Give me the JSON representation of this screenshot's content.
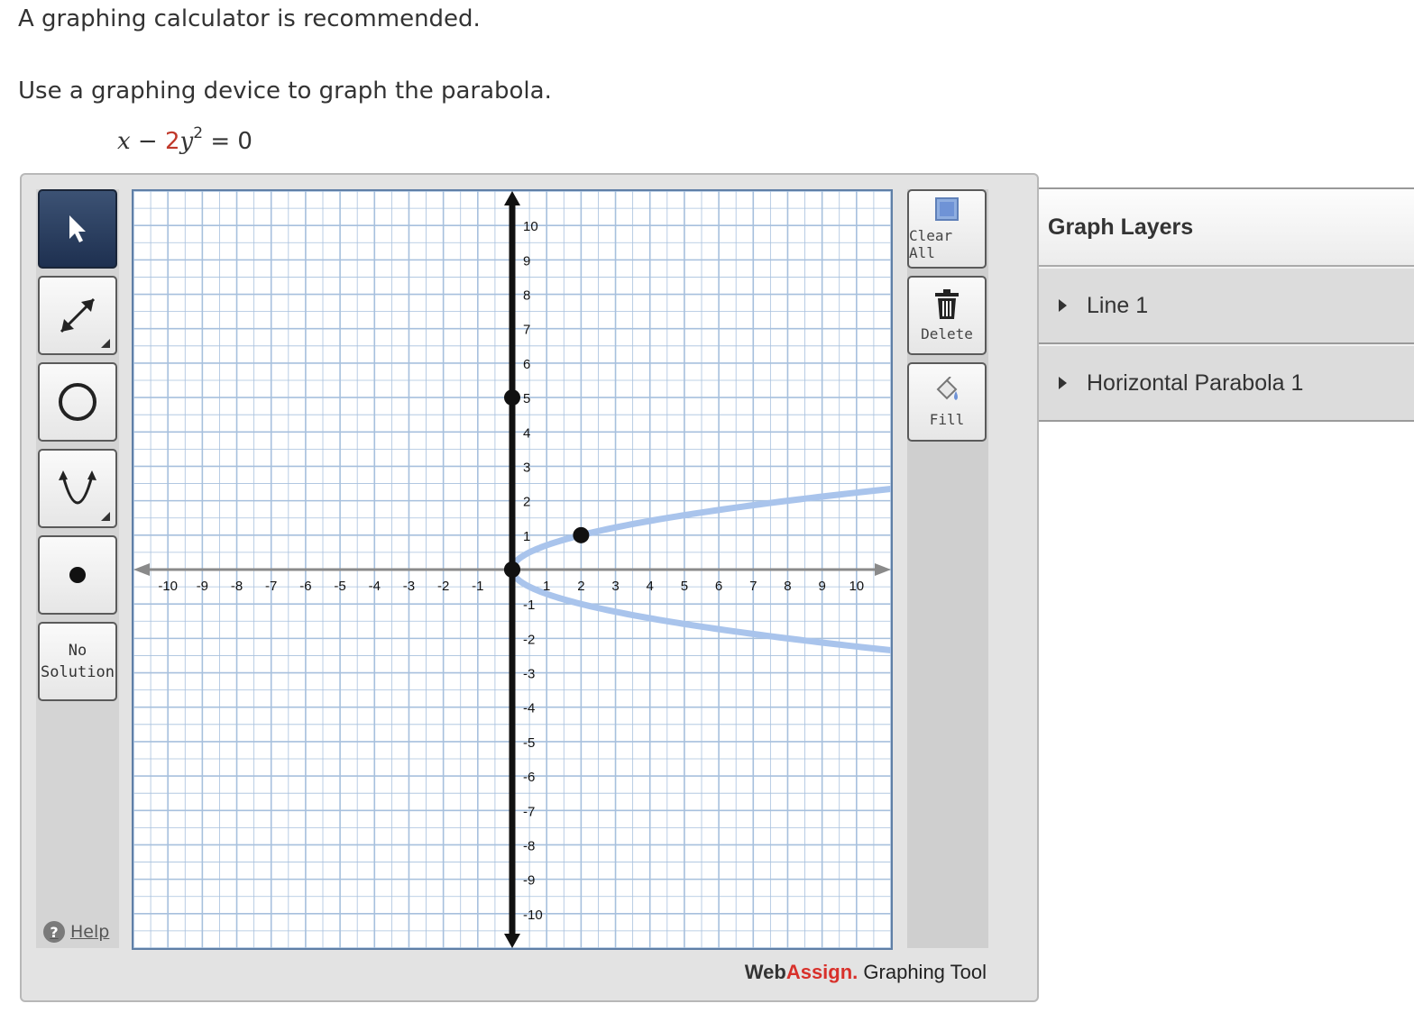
{
  "page": {
    "note": "A graphing calculator is recommended.",
    "instruction": "Use a graphing device to graph the parabola.",
    "equation": {
      "x": "x",
      "minus": " − ",
      "coef": "2",
      "y": "y",
      "exp": "2",
      "rest": " = 0"
    }
  },
  "toolbar_left": {
    "tools": [
      {
        "id": "select",
        "icon": "pointer-arrow-icon",
        "active": true
      },
      {
        "id": "line",
        "icon": "double-arrow-line-icon"
      },
      {
        "id": "circle",
        "icon": "circle-icon"
      },
      {
        "id": "parabola",
        "icon": "parabola-icon"
      },
      {
        "id": "point",
        "icon": "point-icon"
      }
    ],
    "no_solution_line1": "No",
    "no_solution_line2": "Solution",
    "help_label": "Help"
  },
  "toolbar_right": {
    "clear_all": "Clear All",
    "delete": "Delete",
    "fill": "Fill"
  },
  "brand": {
    "web": "Web",
    "assign": "Assign.",
    "tool": " Graphing Tool"
  },
  "layers": {
    "title": "Graph Layers",
    "items": [
      "Line 1",
      "Horizontal Parabola 1"
    ]
  },
  "graph": {
    "x_range": [
      -11,
      11
    ],
    "y_range": [
      -11,
      11
    ],
    "x_ticks": [
      -10,
      -9,
      -8,
      -7,
      -6,
      -5,
      -4,
      -3,
      -2,
      -1,
      1,
      2,
      3,
      4,
      5,
      6,
      7,
      8,
      9,
      10
    ],
    "y_ticks": [
      10,
      9,
      8,
      7,
      6,
      5,
      4,
      3,
      2,
      1,
      -1,
      -2,
      -3,
      -4,
      -5,
      -6,
      -7,
      -8,
      -9,
      -10
    ],
    "line_1": {
      "type": "vertical",
      "x": 0,
      "color": "#111111"
    },
    "line_points": [
      [
        0,
        5
      ],
      [
        0,
        0
      ]
    ],
    "parabola": {
      "type": "horizontal",
      "equation": "x = 2y^2",
      "vertex": [
        0,
        0
      ],
      "point": [
        2,
        1
      ],
      "color": "#a9c4ec"
    },
    "grid_color": "#a7c0dd",
    "axis_color": "#8a8a8a"
  }
}
